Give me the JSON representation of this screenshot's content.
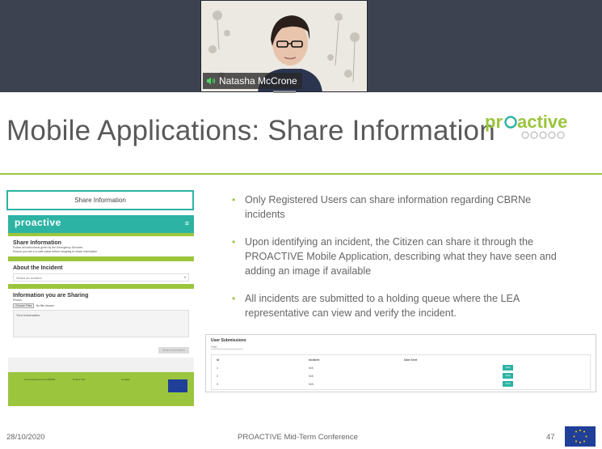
{
  "call": {
    "participant_name": "Natasha McCrone",
    "audio_icon": "speaker-icon"
  },
  "slide": {
    "title": "Mobile Applications: Share Information",
    "logo_text": "PROACTIVE",
    "bullets": [
      "Only Registered Users can share information regarding CBRNe incidents",
      "Upon identifying an incident, the Citizen can share it through the PROACTIVE Mobile Application, describing what they have seen and adding an image if available",
      "All incidents are submitted to a holding queue where the LEA representative can view and verify the incident."
    ],
    "footer": {
      "date": "28/10/2020",
      "conference": "PROACTIVE Mid-Term Conference",
      "page": "47"
    }
  },
  "mock": {
    "button_label": "Share Information",
    "app_logo": "proactive",
    "heading": "Share Information",
    "line1": "Follow all instructions given by the Emergency Services.",
    "line2": "Ensure you are in a safe place before stopping to share information",
    "about_heading": "About the Incident",
    "select_placeholder": "Select an incident",
    "sharing_heading": "Information you are Sharing",
    "photos_label": "Photos",
    "choose_files": "Choose Files",
    "no_file": "No file chosen",
    "your_info": "Your Information",
    "submit": "Share Information",
    "footer_cols": [
      "Grant Agreement No 832981",
      "Project Info",
      "Contact"
    ]
  },
  "submissions": {
    "title": "User Submissions",
    "filter": "Filter",
    "columns": [
      "Id",
      "Incident",
      "Date Sent"
    ],
    "rows": [
      {
        "id": "1",
        "incident": "N/A",
        "date": "",
        "action": "View"
      },
      {
        "id": "2",
        "incident": "N/A",
        "date": "",
        "action": "View"
      },
      {
        "id": "3",
        "incident": "N/A",
        "date": "",
        "action": "View"
      }
    ]
  },
  "colors": {
    "accent_green": "#9bc53d",
    "accent_teal": "#2db3a3",
    "call_background": "#3c4250",
    "eu_blue": "#1f3f99"
  }
}
